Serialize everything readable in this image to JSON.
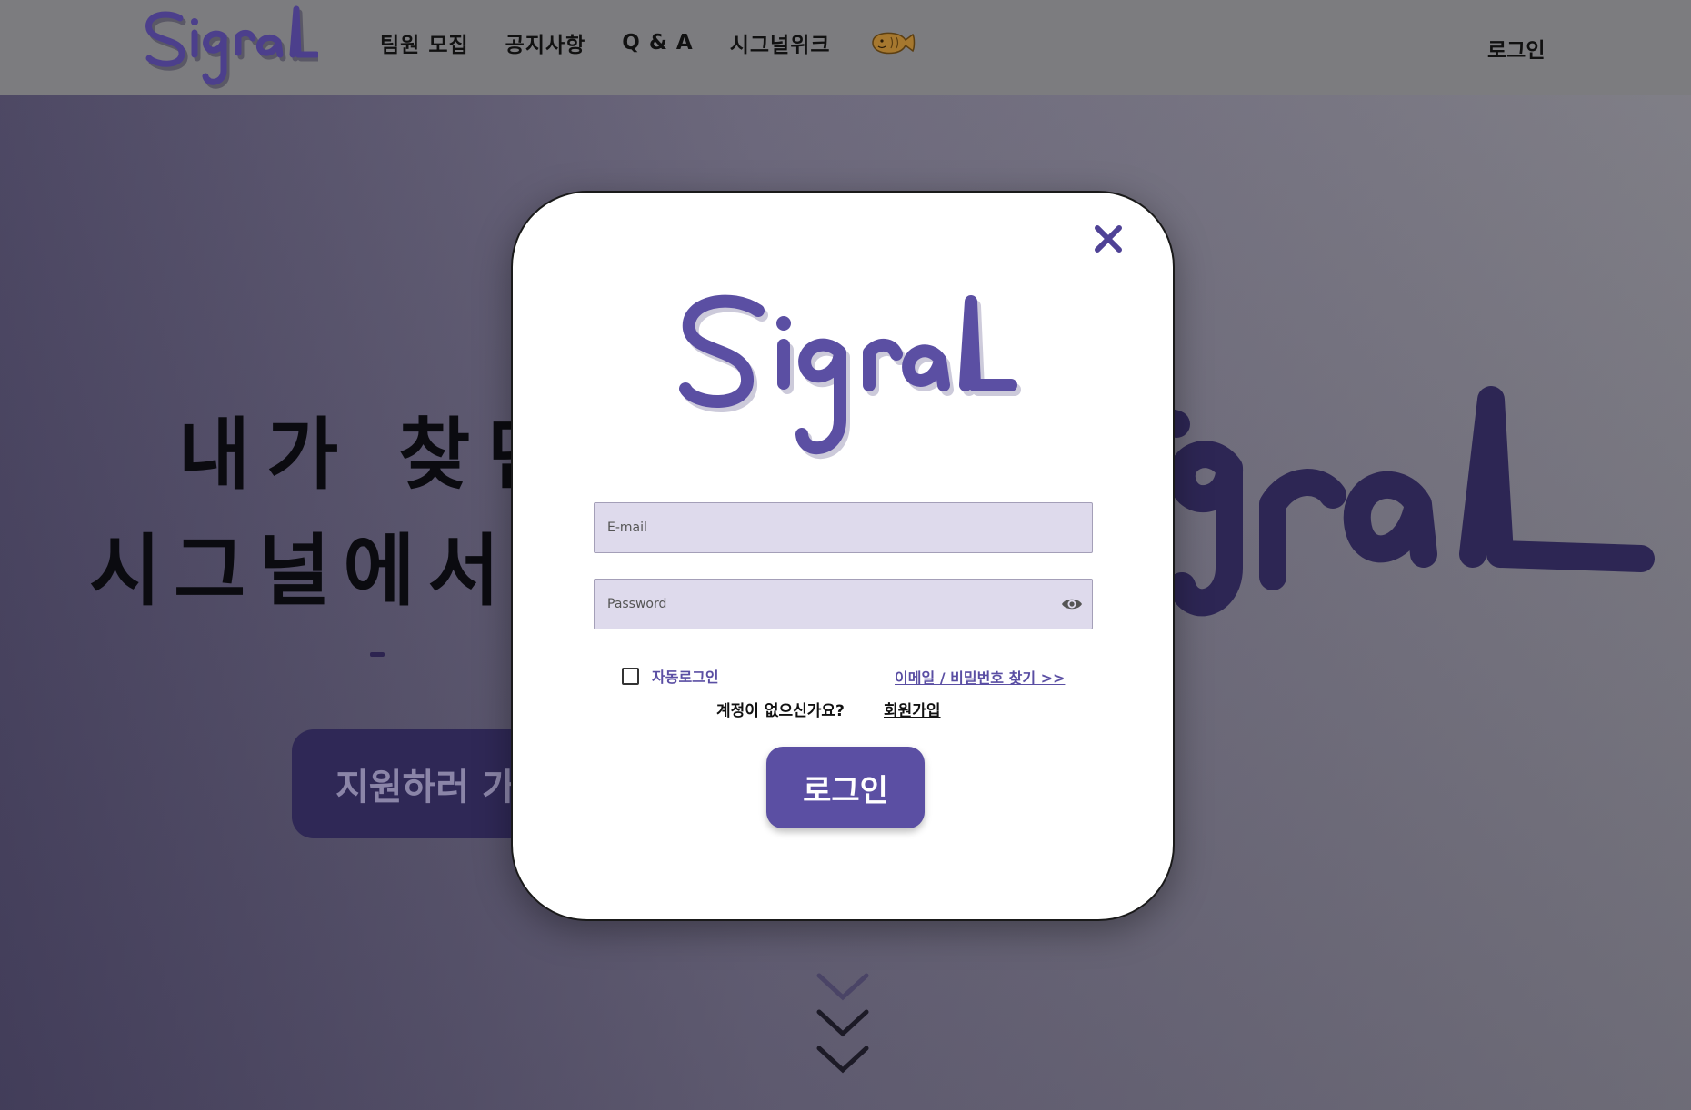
{
  "header": {
    "logo_text": "Signal",
    "nav": [
      "팀원 모집",
      "공지사항",
      "Q & A",
      "시그널위크"
    ],
    "fish_icon": "bungeoppang-icon",
    "login_label": "로그인"
  },
  "hero": {
    "line1": "내가 찾던",
    "line2": "시그널에서 ",
    "apply_label": "지원하러 가"
  },
  "modal": {
    "logo_text": "Signal",
    "email_placeholder": "E-mail",
    "password_placeholder": "Password",
    "auto_login_label": "자동로그인",
    "auto_login_checked": false,
    "find_link": "이메일 / 비밀번호 찾기 >>",
    "no_account_text": "계정이 없으신가요?",
    "signup_link": "회원가입",
    "login_button": "로그인"
  },
  "colors": {
    "brand": "#5b4fa3",
    "brand_dark": "#2f2856",
    "input_bg": "#dedaec",
    "header_bg": "#7c7c7f"
  },
  "icons": [
    "close-icon",
    "eye-icon",
    "chevron-down-icon"
  ]
}
